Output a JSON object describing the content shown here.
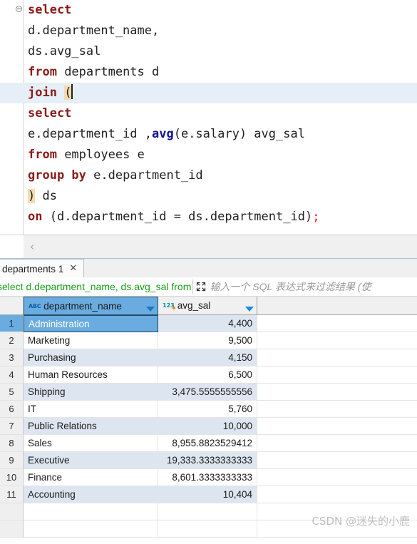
{
  "editor": {
    "fold_marker": "collapse",
    "lines": [
      [
        {
          "t": "select",
          "c": "kw"
        }
      ],
      [
        {
          "t": "d.department_name,",
          "c": "plain"
        }
      ],
      [
        {
          "t": "ds.avg_sal",
          "c": "plain"
        }
      ],
      [
        {
          "t": "from",
          "c": "kw"
        },
        {
          "t": " departments d",
          "c": "plain"
        }
      ],
      [
        {
          "t": "join",
          "c": "kw"
        },
        {
          "t": " ",
          "c": "plain"
        },
        {
          "t": "(",
          "c": "brk"
        },
        {
          "t": "",
          "c": "caret"
        }
      ],
      [
        {
          "t": "select",
          "c": "kw"
        }
      ],
      [
        {
          "t": "e.department_id ,",
          "c": "plain"
        },
        {
          "t": "avg",
          "c": "fn"
        },
        {
          "t": "(e.salary) avg_sal",
          "c": "plain"
        }
      ],
      [
        {
          "t": "from",
          "c": "kw"
        },
        {
          "t": " employees e",
          "c": "plain"
        }
      ],
      [
        {
          "t": "group by",
          "c": "kw"
        },
        {
          "t": " e.department_id",
          "c": "plain"
        }
      ],
      [
        {
          "t": ")",
          "c": "brk"
        },
        {
          "t": " ds",
          "c": "plain"
        }
      ],
      [
        {
          "t": "on",
          "c": "kw"
        },
        {
          "t": " (d.department_id = ds.department_id)",
          "c": "plain"
        },
        {
          "t": ";",
          "c": "punct-red"
        }
      ]
    ],
    "caret_line_index": 4,
    "full_text": "select\nd.department_name,\nds.avg_sal\nfrom departments d\njoin (\nselect\ne.department_id ,avg(e.salary) avg_sal\nfrom employees e\ngroup by e.department_id\n) ds\non (d.department_id = ds.department_id);"
  },
  "toolbar": {
    "collapse_chevron": "‹"
  },
  "result_tab": {
    "label": "departments 1",
    "close": "✕"
  },
  "filter_bar": {
    "sql_text": "select d.department_name, ds.avg_sal from ",
    "placeholder": "输入一个 SQL 表达式来过滤结果 (使",
    "sql_color": "#18a018"
  },
  "grid": {
    "columns": [
      {
        "name": "department_name",
        "type_icon": "abc-icon",
        "type_label": "ABC",
        "selected": true,
        "align": "left"
      },
      {
        "name": "avg_sal",
        "type_icon": "123-icon",
        "type_label": "123",
        "selected": false,
        "align": "right"
      }
    ],
    "rows": [
      {
        "n": "1",
        "department_name": "Administration",
        "avg_sal": "4,400"
      },
      {
        "n": "2",
        "department_name": "Marketing",
        "avg_sal": "9,500"
      },
      {
        "n": "3",
        "department_name": "Purchasing",
        "avg_sal": "4,150"
      },
      {
        "n": "4",
        "department_name": "Human Resources",
        "avg_sal": "6,500"
      },
      {
        "n": "5",
        "department_name": "Shipping",
        "avg_sal": "3,475.5555555556"
      },
      {
        "n": "6",
        "department_name": "IT",
        "avg_sal": "5,760"
      },
      {
        "n": "7",
        "department_name": "Public Relations",
        "avg_sal": "10,000"
      },
      {
        "n": "8",
        "department_name": "Sales",
        "avg_sal": "8,955.8823529412"
      },
      {
        "n": "9",
        "department_name": "Executive",
        "avg_sal": "19,333.3333333333"
      },
      {
        "n": "10",
        "department_name": "Finance",
        "avg_sal": "8,601.3333333333"
      },
      {
        "n": "11",
        "department_name": "Accounting",
        "avg_sal": "10,404"
      }
    ],
    "selected_row": 1,
    "selected_cell": "department_name",
    "filler_rows": 2
  },
  "watermark": {
    "text": "CSDN @迷失的小鹿"
  },
  "colors": {
    "accent_blue": "#6aace0",
    "keyword_red": "#8b1a1a",
    "function_blue": "#101095",
    "sql_green": "#18a018",
    "row_stripe": "#dde6f0",
    "bracket_highlight": "#f2dcb0"
  }
}
